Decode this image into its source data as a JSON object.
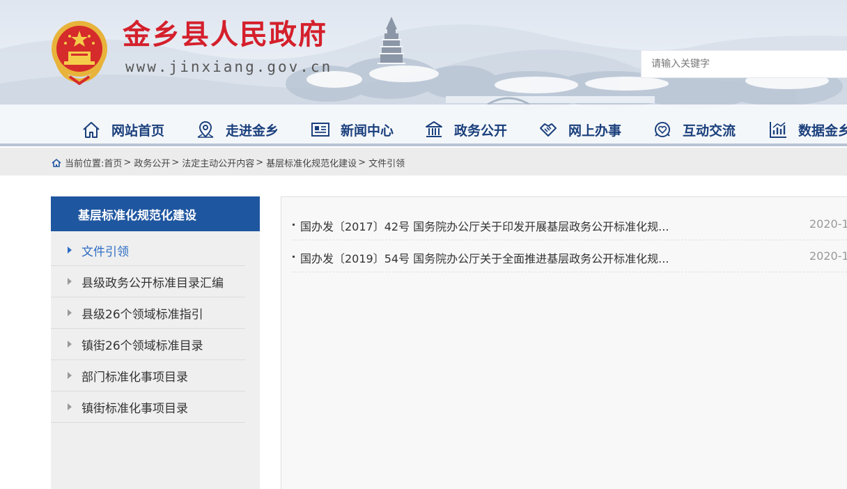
{
  "header": {
    "site_title": "金乡县人民政府",
    "site_url": "www.jinxiang.gov.cn",
    "search_placeholder": "请输入关键字"
  },
  "nav": {
    "items": [
      {
        "label": "网站首页",
        "icon": "home-icon"
      },
      {
        "label": "走进金乡",
        "icon": "map-pin-icon"
      },
      {
        "label": "新闻中心",
        "icon": "newspaper-icon"
      },
      {
        "label": "政务公开",
        "icon": "government-building-icon"
      },
      {
        "label": "网上办事",
        "icon": "handshake-icon"
      },
      {
        "label": "互动交流",
        "icon": "chat-heart-icon"
      },
      {
        "label": "数据金乡",
        "icon": "bar-chart-icon"
      }
    ]
  },
  "breadcrumb": {
    "prefix": "当前位置:",
    "items": [
      "首页",
      "政务公开",
      "法定主动公开内容",
      "基层标准化规范化建设",
      "文件引领"
    ],
    "separator": ">"
  },
  "sidebar": {
    "heading": "基层标准化规范化建设",
    "items": [
      {
        "label": "文件引领",
        "active": true
      },
      {
        "label": "县级政务公开标准目录汇编",
        "active": false
      },
      {
        "label": "县级26个领域标准指引",
        "active": false
      },
      {
        "label": "镇街26个领域标准目录",
        "active": false
      },
      {
        "label": "部门标准化事项目录",
        "active": false
      },
      {
        "label": "镇街标准化事项目录",
        "active": false
      }
    ]
  },
  "documents": [
    {
      "title": "国办发〔2017〕42号 国务院办公厅关于印发开展基层政务公开标准化规...",
      "date": "2020-1"
    },
    {
      "title": "国办发〔2019〕54号 国务院办公厅关于全面推进基层政务公开标准化规...",
      "date": "2020-1"
    }
  ],
  "colors": {
    "brand_red": "#d4202c",
    "nav_blue": "#1a3f7c",
    "sidebar_head_blue": "#1f56a0",
    "active_link_blue": "#2c6cc4"
  }
}
